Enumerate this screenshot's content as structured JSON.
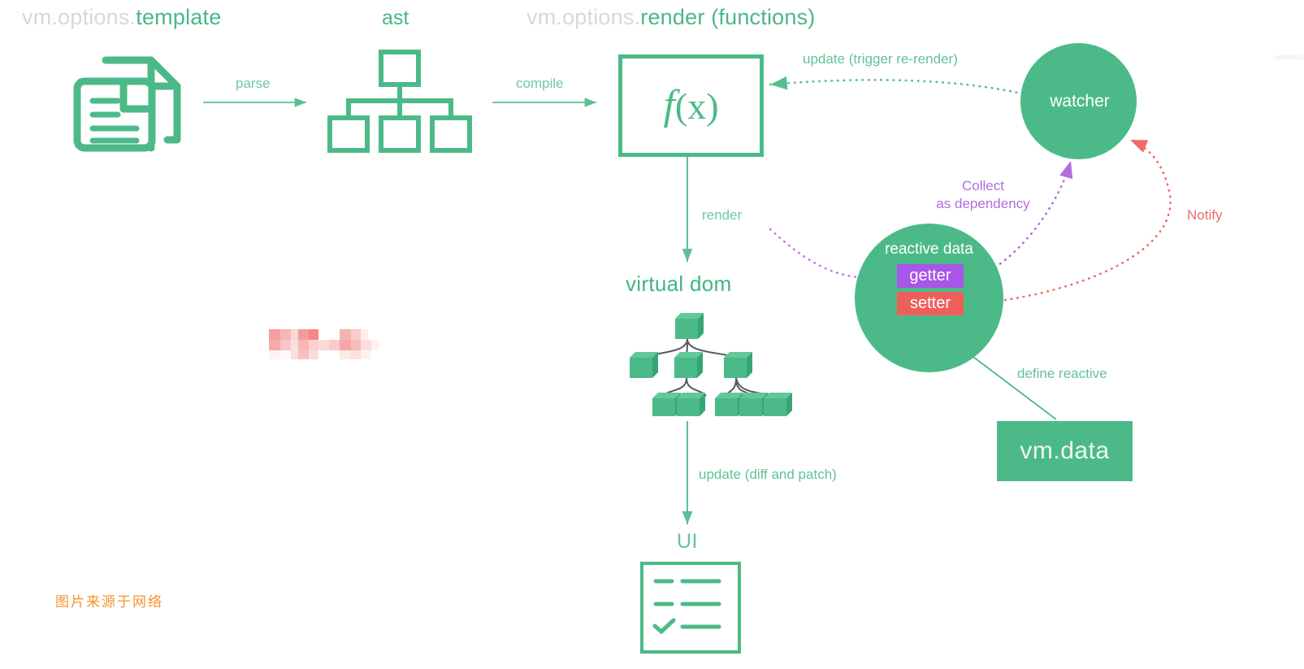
{
  "diagram": {
    "title": "Vue reactivity / render pipeline diagram",
    "background": "#ffffff",
    "colors": {
      "green": "#4cba88",
      "green_text": "#49b885",
      "green_muted": "#6fc89f",
      "dim_gray": "#d7d8d8",
      "purple": "#a855e8",
      "purple_text": "#b06de0",
      "red": "#ef5f5a",
      "red_text": "#ef6b6b",
      "orange": "#f5922f",
      "white": "#ffffff"
    }
  },
  "headings": {
    "template": {
      "prefix": "vm.options.",
      "accent": "template"
    },
    "ast": "ast",
    "render": {
      "prefix": "vm.options.",
      "accent": "render (functions)"
    }
  },
  "edges": {
    "parse": "parse",
    "compile": "compile",
    "render": "render",
    "update_trigger": "update (trigger re-render)",
    "collect_as_dependency": "Collect\nas dependency",
    "collect_line1": "Collect",
    "collect_line2": "as dependency",
    "notify": "Notify",
    "define_reactive": "define reactive",
    "update_diff_patch": "update (diff and patch)"
  },
  "nodes": {
    "template_icon": "documents-icon",
    "ast_tree_icon": "tree-hierarchy-icon",
    "render_fn": {
      "label": "f(x)",
      "fn": "f",
      "arg": "(x)"
    },
    "virtual_dom": {
      "title": "virtual dom",
      "icon": "cube-tree-icon"
    },
    "ui": {
      "title": "UI",
      "icon": "checklist-icon"
    },
    "watcher": {
      "label": "watcher"
    },
    "reactive_data": {
      "label": "reactive data",
      "getter": "getter",
      "setter": "setter"
    },
    "vm_data": {
      "label": "vm.data"
    }
  },
  "annotations": {
    "credit": "图片来源于网络",
    "redaction": "redacted-blurred-text"
  }
}
